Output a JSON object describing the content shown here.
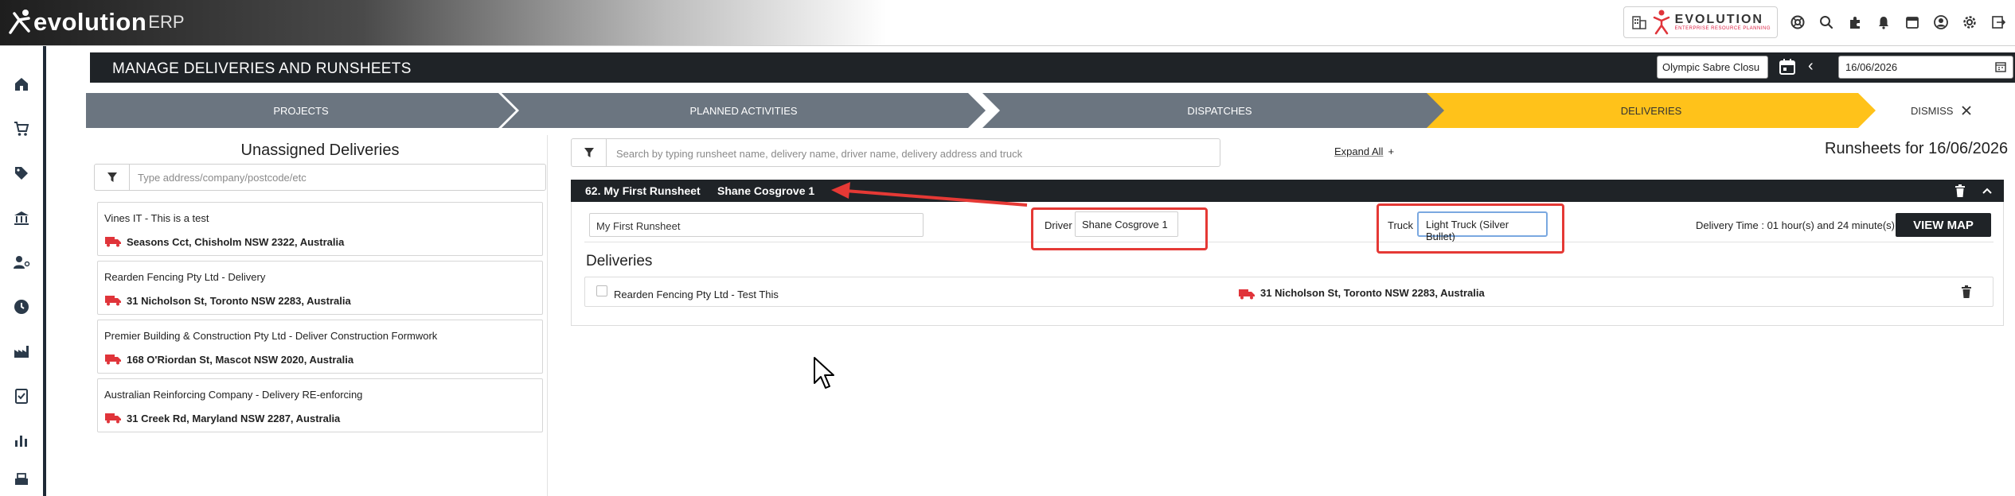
{
  "app": {
    "brand_word": "evolution",
    "brand_suffix": "ERP",
    "logo_main": "EVOLUTION",
    "logo_sub": "ENTERPRISE RESOURCE PLANNING"
  },
  "topbar_icons": [
    "building-icon",
    "search-icon",
    "extensions-icon",
    "notifications-icon",
    "calendar-icon",
    "account-icon",
    "settings-icon",
    "logout-icon"
  ],
  "nav": [
    "home-icon",
    "cart-icon",
    "tag-icon",
    "bank-icon",
    "people-settings-icon",
    "clock-icon",
    "factory-icon",
    "clipboard-check-icon",
    "bar-chart-icon",
    "print-icon"
  ],
  "header": {
    "title": "MANAGE DELIVERIES AND RUNSHEETS",
    "select_value": "Olympic Sabre Closu",
    "date_value": "16/06/2026",
    "prev": "‹",
    "next": "›",
    "add": "+"
  },
  "stepper": {
    "steps": [
      "PROJECTS",
      "PLANNED ACTIVITIES",
      "DISPATCHES",
      "DELIVERIES"
    ],
    "dismiss": "DISMISS",
    "active": "DELIVERIES"
  },
  "unassigned": {
    "title": "Unassigned Deliveries",
    "placeholder": "Type address/company/postcode/etc",
    "items": [
      {
        "name": "Vines IT - This is a test",
        "address": "Seasons Cct, Chisholm NSW 2322, Australia"
      },
      {
        "name": "Rearden Fencing Pty Ltd - Delivery",
        "address": "31 Nicholson St, Toronto NSW 2283, Australia"
      },
      {
        "name": "Premier Building & Construction Pty Ltd - Deliver Construction Formwork",
        "address": "168 O'Riordan St, Mascot NSW 2020, Australia"
      },
      {
        "name": "Australian Reinforcing Company - Delivery RE-enforcing",
        "address": "31 Creek Rd, Maryland NSW 2287, Australia"
      }
    ]
  },
  "runsheets": {
    "search_placeholder": "Search by typing runsheet name, delivery name, driver name, delivery address and truck",
    "expand_all": "Expand All",
    "expand_icon": "+",
    "title": "Runsheets for 16/06/2026",
    "runsheet": {
      "header_name": "62. My First Runsheet",
      "header_driver": "Shane Cosgrove 1",
      "name_value": "My First Runsheet",
      "driver_label": "Driver",
      "driver_value": "Shane Cosgrove 1",
      "truck_label": "Truck",
      "truck_value": "Light Truck (Silver Bullet)",
      "delivery_time": "Delivery Time : 01 hour(s) and 24 minute(s)",
      "view_map": "VIEW MAP",
      "deliveries_heading": "Deliveries",
      "deliveries": [
        {
          "name": "Rearden Fencing Pty Ltd - Test This",
          "address": "31 Nicholson St, Toronto NSW 2283, Australia"
        }
      ]
    }
  },
  "colors": {
    "accent_yellow": "#ffc21a",
    "step_gray": "#6b7580",
    "dark_bar": "#1f2327",
    "truck_red": "#e0343a",
    "annotation_red": "#e53935"
  }
}
